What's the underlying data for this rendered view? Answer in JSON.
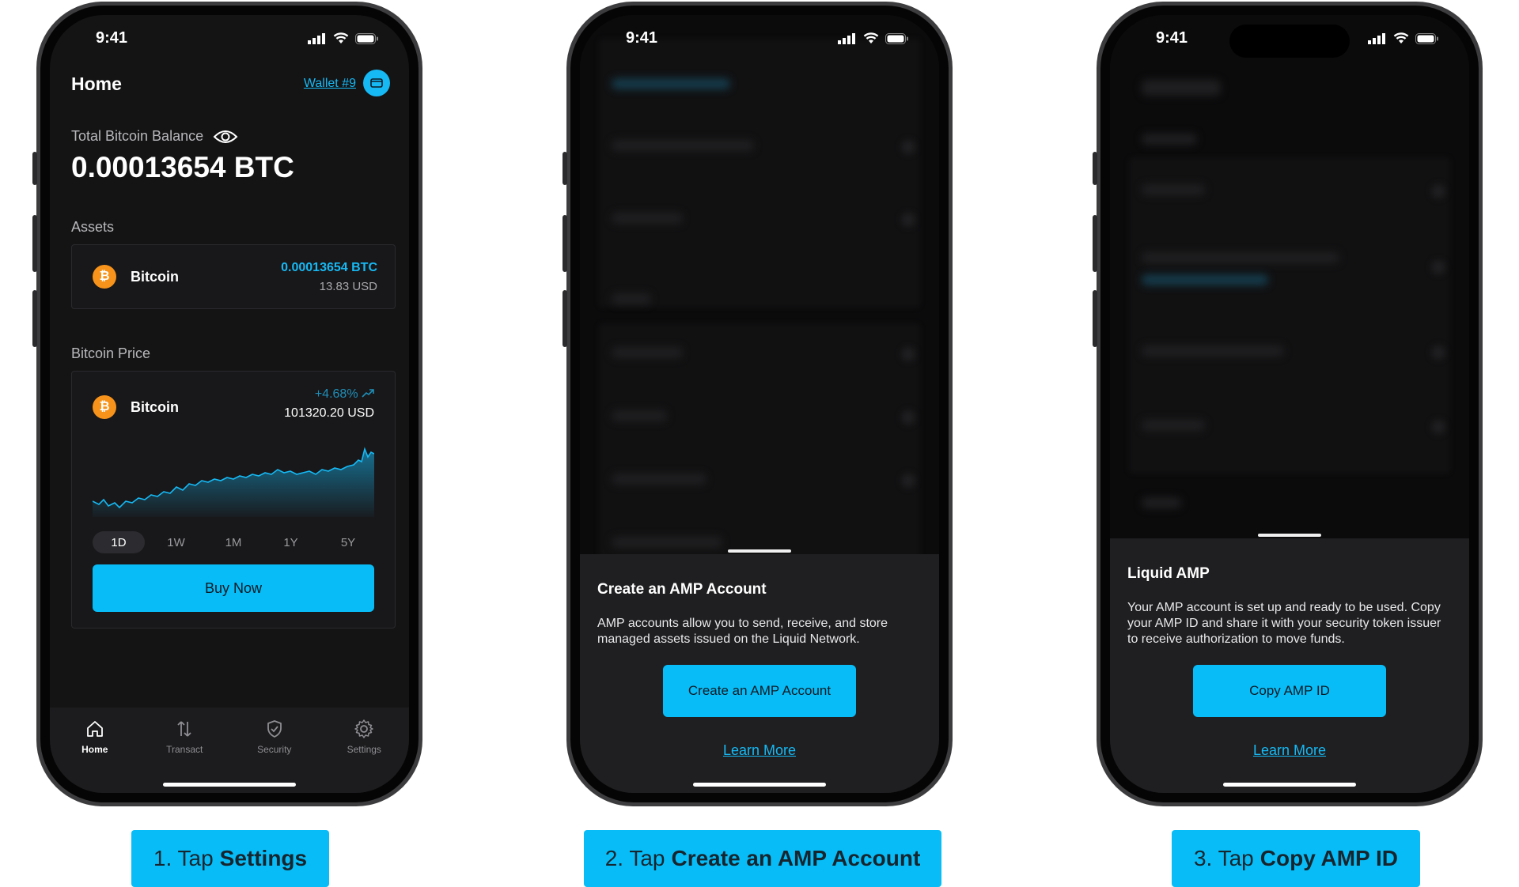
{
  "status": {
    "time": "9:41"
  },
  "home": {
    "title": "Home",
    "wallet_link": "Wallet #9",
    "balance_label": "Total Bitcoin Balance",
    "balance_value": "0.00013654 BTC",
    "assets_label": "Assets",
    "asset": {
      "name": "Bitcoin",
      "icon": "bitcoin-icon",
      "amount_btc": "0.00013654 BTC",
      "amount_usd": "13.83 USD"
    },
    "price_label": "Bitcoin Price",
    "price_card": {
      "name": "Bitcoin",
      "change": "+4.68%",
      "price": "101320.20 USD"
    },
    "ranges": [
      "1D",
      "1W",
      "1M",
      "1Y",
      "5Y"
    ],
    "active_range": "1D",
    "buy_button": "Buy Now",
    "tabs": [
      {
        "label": "Home",
        "icon": "home-icon",
        "active": true
      },
      {
        "label": "Transact",
        "icon": "transact-icon",
        "active": false
      },
      {
        "label": "Security",
        "icon": "shield-icon",
        "active": false
      },
      {
        "label": "Settings",
        "icon": "gear-icon",
        "active": false
      }
    ]
  },
  "create_sheet": {
    "title": "Create an AMP Account",
    "body": "AMP accounts allow you to send, receive, and store managed assets issued on the Liquid Network.",
    "button": "Create an AMP Account",
    "learn_more": "Learn More"
  },
  "copy_sheet": {
    "title": "Liquid AMP",
    "body": "Your AMP account is set up and ready to be used. Copy your AMP ID and share it with your security token issuer to receive authorization to move funds.",
    "button": "Copy AMP ID",
    "learn_more": "Learn More"
  },
  "captions": [
    {
      "prefix": "1. Tap",
      "bold": "Settings"
    },
    {
      "prefix": "2. Tap",
      "bold": "Create an AMP Account"
    },
    {
      "prefix": "3. Tap",
      "bold": "Copy AMP ID"
    }
  ],
  "colors": {
    "accent": "#08bdf7",
    "link": "#16b9f4",
    "bitcoin": "#f7931a",
    "background": "#141415",
    "sheet": "#1f1f21"
  }
}
